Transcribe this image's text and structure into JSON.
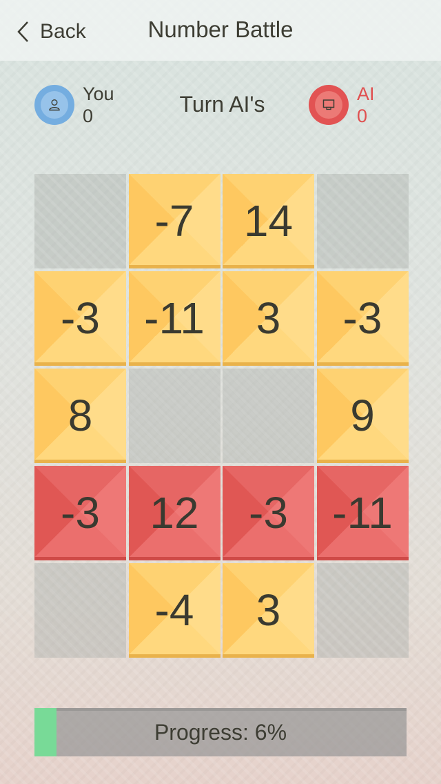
{
  "navbar": {
    "back_label": "Back",
    "title": "Number Battle"
  },
  "players": {
    "you": {
      "name": "You",
      "score": "0",
      "icon": "user-icon",
      "color": "#74ade0"
    },
    "ai": {
      "name": "AI",
      "score": "0",
      "icon": "monitor-icon",
      "color": "#e25353"
    }
  },
  "turn_label": "Turn AI's",
  "board": {
    "rows": [
      [
        {
          "value": "",
          "type": "empty"
        },
        {
          "value": "-7",
          "type": "yellow"
        },
        {
          "value": "14",
          "type": "yellow"
        },
        {
          "value": "",
          "type": "empty"
        }
      ],
      [
        {
          "value": "-3",
          "type": "yellow"
        },
        {
          "value": "-11",
          "type": "yellow"
        },
        {
          "value": "3",
          "type": "yellow"
        },
        {
          "value": "-3",
          "type": "yellow"
        }
      ],
      [
        {
          "value": "8",
          "type": "yellow"
        },
        {
          "value": "",
          "type": "empty"
        },
        {
          "value": "",
          "type": "empty"
        },
        {
          "value": "9",
          "type": "yellow"
        }
      ],
      [
        {
          "value": "-3",
          "type": "red"
        },
        {
          "value": "12",
          "type": "red"
        },
        {
          "value": "-3",
          "type": "red"
        },
        {
          "value": "-11",
          "type": "red"
        }
      ],
      [
        {
          "value": "",
          "type": "empty"
        },
        {
          "value": "-4",
          "type": "yellow"
        },
        {
          "value": "3",
          "type": "yellow"
        },
        {
          "value": "",
          "type": "empty"
        }
      ]
    ]
  },
  "progress": {
    "label": "Progress: 6%",
    "percent": 6,
    "fill_color": "#78da97"
  }
}
